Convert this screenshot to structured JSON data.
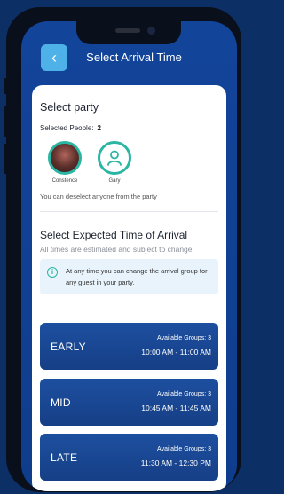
{
  "header": {
    "title": "Select Arrival Time",
    "back_icon": "‹"
  },
  "party": {
    "heading": "Select party",
    "selected_label": "Selected People:",
    "selected_count": "2",
    "people": [
      {
        "name": "Constence",
        "avatar": "photo"
      },
      {
        "name": "Gary",
        "avatar": "user-icon"
      }
    ],
    "hint": "You can deselect anyone from the party"
  },
  "eta": {
    "heading": "Select Expected Time of Arrival",
    "subtitle": "All times are estimated and subject to change.",
    "info_icon": "i",
    "info_text": "At any time you can change the arrival group for any guest in your party."
  },
  "groups": [
    {
      "label": "EARLY",
      "available": "Available Groups: 3",
      "time": "10:00 AM - 11:00 AM"
    },
    {
      "label": "MID",
      "available": "Available Groups: 3",
      "time": "10:45 AM - 11:45 AM"
    },
    {
      "label": "LATE",
      "available": "Available Groups: 3",
      "time": "11:30 AM - 12:30 PM"
    }
  ],
  "colors": {
    "accent": "#2ab6a2",
    "primary": "#1d4fa0",
    "back_button": "#4eb2e8",
    "background": "#0c2f66"
  }
}
